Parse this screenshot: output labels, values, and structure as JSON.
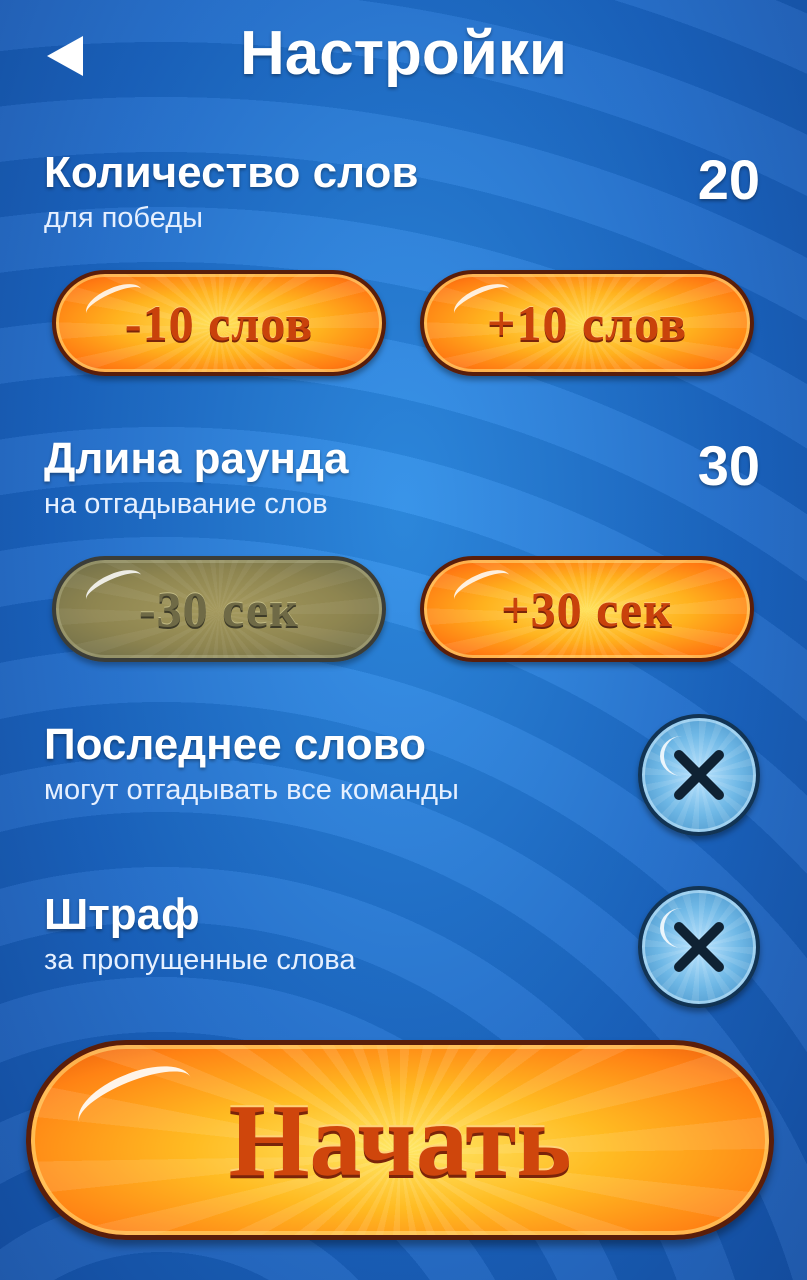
{
  "header": {
    "title": "Настройки",
    "back_icon": "back-arrow-icon"
  },
  "words_count": {
    "title": "Количество слов",
    "subtitle": "для победы",
    "value": "20",
    "minus_label": "-10 слов",
    "plus_label": "+10 слов"
  },
  "round_length": {
    "title": "Длина раунда",
    "subtitle": "на отгадывание слов",
    "value": "30",
    "minus_label": "-30 сек",
    "minus_disabled": true,
    "plus_label": "+30 сек"
  },
  "last_word": {
    "title": "Последнее слово",
    "subtitle": "могут отгадывать все команды",
    "enabled": false,
    "icon": "close-x-icon"
  },
  "penalty": {
    "title": "Штраф",
    "subtitle": "за пропущенные слова",
    "enabled": false,
    "icon": "close-x-icon"
  },
  "start": {
    "label": "Начать"
  },
  "colors": {
    "background": "#1b66c4",
    "button_orange": "#ffb21e",
    "button_text": "#c9420b",
    "toggle_blue": "#6fb8e6"
  }
}
